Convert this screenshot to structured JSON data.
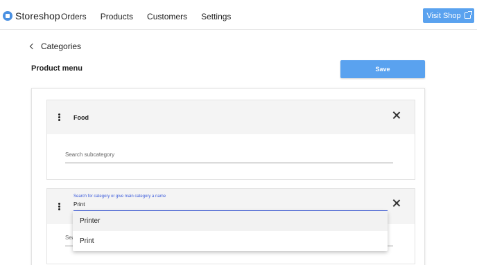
{
  "header": {
    "brand": "Storeshop",
    "nav": [
      "Orders",
      "Products",
      "Customers",
      "Settings"
    ],
    "visit_shop_label": "Visit Shop",
    "accent_color": "#5aa2ef"
  },
  "breadcrumb": {
    "back_label": "Categories"
  },
  "page": {
    "title": "Product menu",
    "save_label": "Save"
  },
  "categories": [
    {
      "name": "Food",
      "subcategory_placeholder": "Search subcategory"
    },
    {
      "search_label": "Search for category or give main category a name",
      "search_value": "Print",
      "subcategory_placeholder_visible": "Sea"
    }
  ],
  "dropdown": {
    "options": [
      "Printer",
      "Print"
    ],
    "highlighted": "Printer"
  },
  "icons": {
    "brand": "storeshop-logo-icon",
    "external": "external-link-icon",
    "back": "chevron-left-icon",
    "drag": "drag-handle-icon",
    "remove": "close-icon"
  }
}
